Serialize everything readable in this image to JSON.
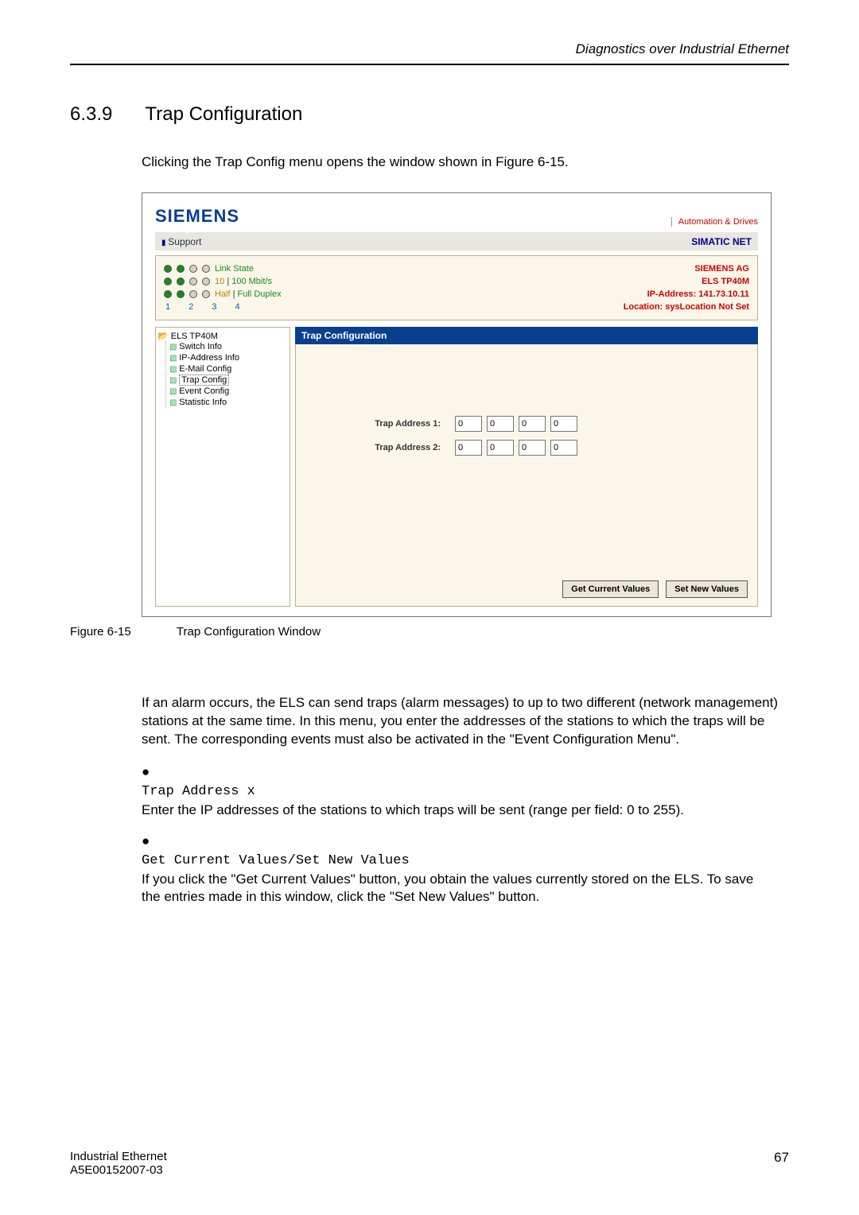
{
  "running_head": "Diagnostics over Industrial Ethernet",
  "section": {
    "number": "6.3.9",
    "title": "Trap Configuration"
  },
  "lead": "Clicking the Trap Config menu opens the window shown in Figure 6-15.",
  "window": {
    "brand": "SIEMENS",
    "brand_right": "Automation & Drives",
    "support_left": "Support",
    "support_right": "SIMATIC NET",
    "led_rows": [
      {
        "states": [
          "g",
          "g",
          "o",
          "o"
        ],
        "label_plain": "Link State",
        "label_half": "",
        "label_full": ""
      },
      {
        "states": [
          "g",
          "g",
          "o",
          "o"
        ],
        "label_plain": "",
        "label_half": "10",
        "label_full": "100 Mbit/s"
      },
      {
        "states": [
          "g",
          "g",
          "o",
          "o"
        ],
        "label_plain": "",
        "label_half": "Half",
        "label_full": "Full Duplex"
      }
    ],
    "port_numbers": "1  2  3  4",
    "info_right": [
      "SIEMENS AG",
      "ELS TP40M",
      "IP-Address: 141.73.10.11",
      "Location: sysLocation Not Set"
    ],
    "tree_root": "ELS TP40M",
    "tree_items": [
      "Switch Info",
      "IP-Address Info",
      "E-Mail Config",
      "Trap Config",
      "Event Config",
      "Statistic Info"
    ],
    "content_title": "Trap Configuration",
    "trap1_label": "Trap Address 1:",
    "trap2_label": "Trap Address 2:",
    "trap1": [
      "0",
      "0",
      "0",
      "0"
    ],
    "trap2": [
      "0",
      "0",
      "0",
      "0"
    ],
    "btn_get": "Get Current Values",
    "btn_set": "Set New Values"
  },
  "figure": {
    "number": "Figure 6-15",
    "caption": "Trap Configuration Window"
  },
  "para": "If an alarm occurs, the ELS can send traps (alarm messages) to up to two different (network management) stations at the same time. In this menu, you enter the addresses of the stations to which the traps will be sent. The corresponding events must also be activated in the \"Event Configuration Menu\".",
  "bullets": [
    {
      "title": "Trap Address x",
      "text": "Enter the IP addresses of the stations to which traps will be sent (range per field: 0 to 255)."
    },
    {
      "title": "Get Current Values/Set New Values",
      "text": "If you click the \"Get Current Values\" button, you obtain the values currently stored on the ELS. To save the entries made in this window, click the \"Set New Values\" button."
    }
  ],
  "footer": {
    "left1": "Industrial Ethernet",
    "left2": "A5E00152007-03",
    "right": "67"
  }
}
